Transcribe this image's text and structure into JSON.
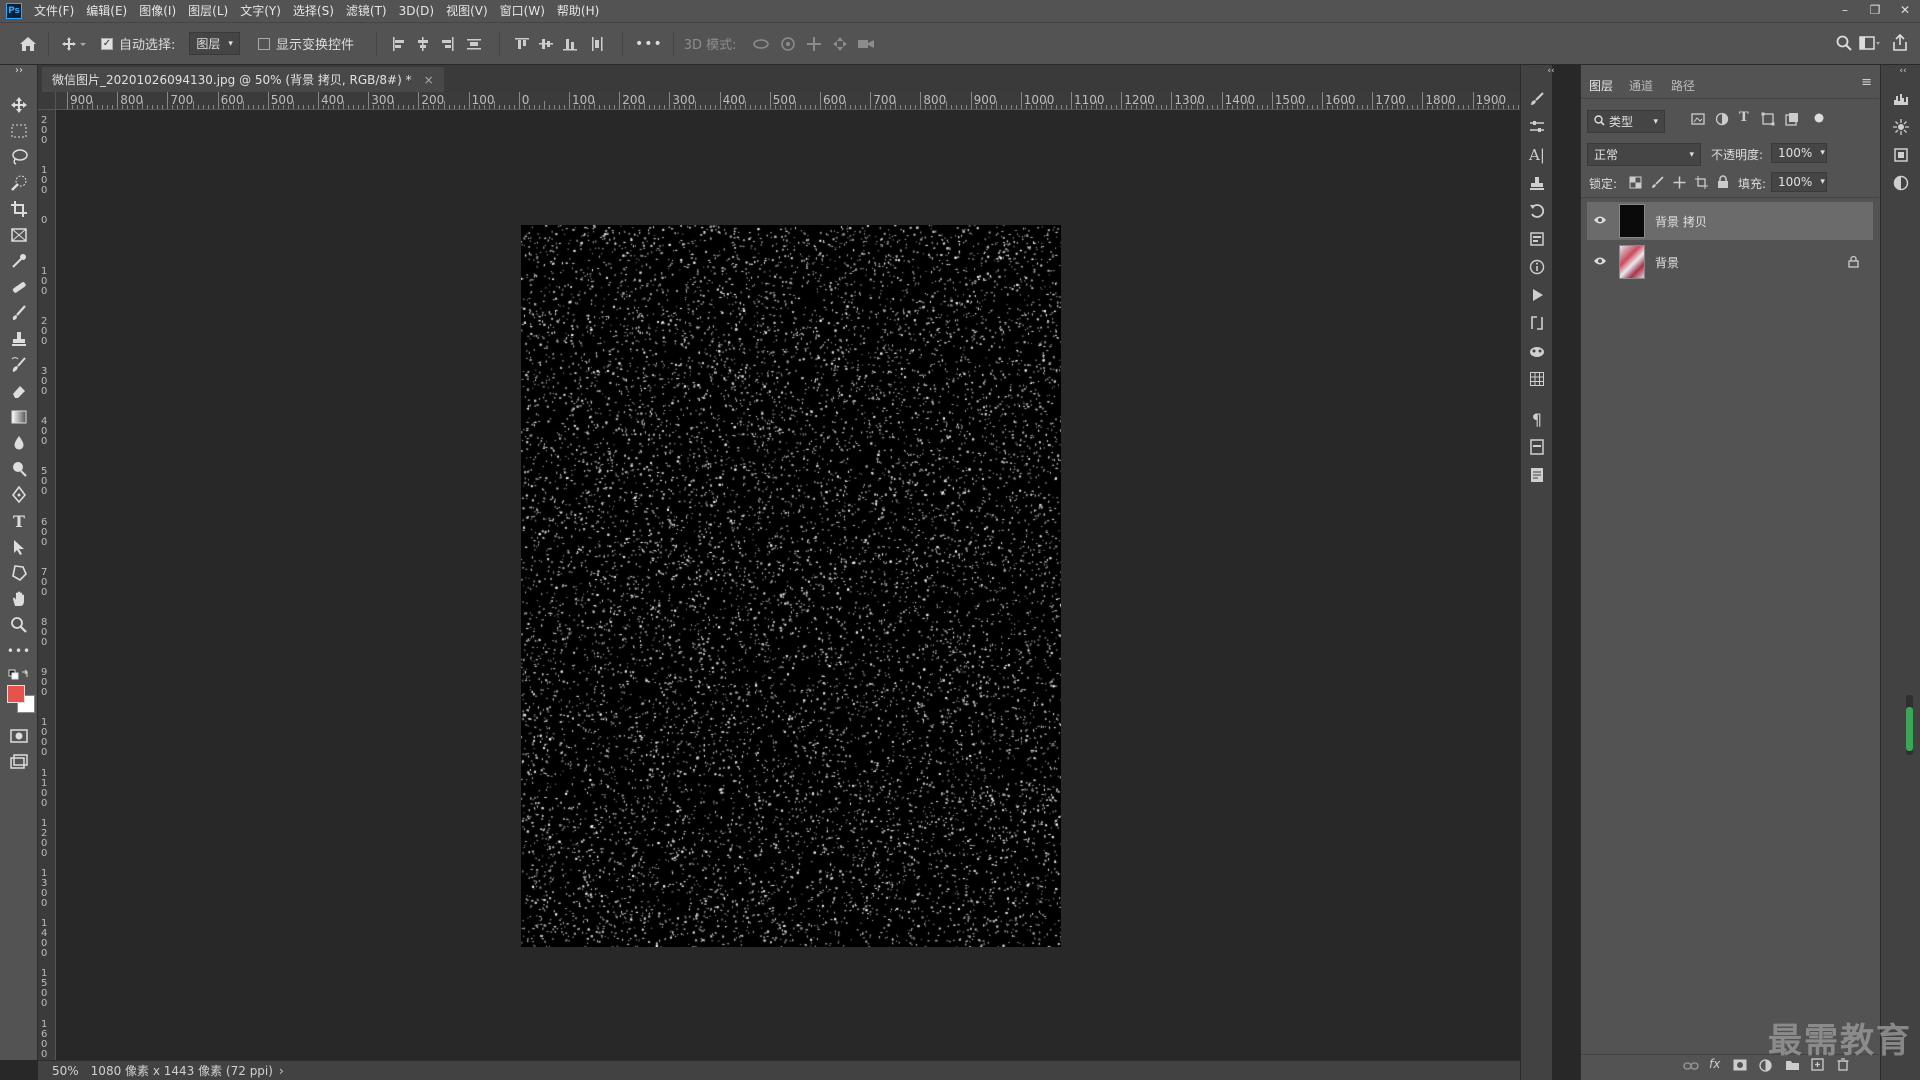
{
  "app": {
    "logo_text": "Ps"
  },
  "menu": [
    "文件(F)",
    "编辑(E)",
    "图像(I)",
    "图层(L)",
    "文字(Y)",
    "选择(S)",
    "滤镜(T)",
    "3D(D)",
    "视图(V)",
    "窗口(W)",
    "帮助(H)"
  ],
  "window_controls": {
    "minimize": "–",
    "restore": "❐",
    "close": "✕"
  },
  "options": {
    "home_icon": "home-icon",
    "auto_select_label": "自动选择:",
    "auto_select_checked": true,
    "auto_select_value": "图层",
    "show_transform_label": "显示变换控件",
    "more": "•••",
    "mode_3d_label": "3D 模式:"
  },
  "document_tab": {
    "title": "微信图片_20201026094130.jpg @ 50% (背景 拷贝, RGB/8#) *",
    "close": "×"
  },
  "rulers": {
    "horizontal": [
      "900",
      "800",
      "700",
      "600",
      "500",
      "400",
      "300",
      "200",
      "100",
      "0",
      "100",
      "200",
      "300",
      "400",
      "500",
      "600",
      "700",
      "800",
      "900",
      "1000",
      "1100",
      "1200",
      "1300",
      "1400",
      "1500",
      "1600",
      "1700",
      "1800",
      "1900"
    ],
    "vertical": [
      "200",
      "100",
      "0",
      "100",
      "200",
      "300",
      "400",
      "500",
      "600",
      "700",
      "800",
      "900",
      "1000",
      "1100",
      "1200",
      "1300",
      "1400",
      "1500",
      "1600"
    ]
  },
  "status": {
    "zoom": "50%",
    "info": "1080 像素 x 1443 像素 (72 ppi)",
    "arrow": "›"
  },
  "panels": {
    "tabs": [
      "图层",
      "通道",
      "路径"
    ],
    "filter_kind": "类型",
    "blend_mode": "正常",
    "opacity_label": "不透明度:",
    "opacity_value": "100%",
    "lock_label": "锁定:",
    "fill_label": "填充:",
    "fill_value": "100%",
    "layers": [
      {
        "name": "背景 拷贝",
        "selected": true,
        "locked": false
      },
      {
        "name": "背景",
        "selected": false,
        "locked": true
      }
    ]
  },
  "colors": {
    "foreground": "#e8524c",
    "background": "#ffffff",
    "accent": "#31a8ff"
  },
  "watermark": "最需教育"
}
